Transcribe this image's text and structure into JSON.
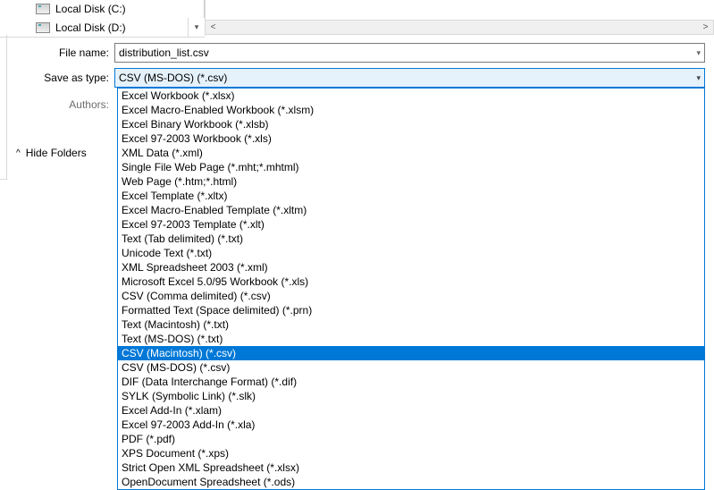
{
  "tree": {
    "items": [
      {
        "label": "Local Disk (C:)"
      },
      {
        "label": "Local Disk (D:)"
      }
    ]
  },
  "form": {
    "filename_label": "File name:",
    "filename_value": "distribution_list.csv",
    "saveastype_label": "Save as type:",
    "saveastype_value": "CSV (MS-DOS) (*.csv)",
    "authors_label": "Authors:"
  },
  "hide_folders_label": "Hide Folders",
  "dropdown": {
    "selected_index": 18,
    "options": [
      "Excel Workbook (*.xlsx)",
      "Excel Macro-Enabled Workbook (*.xlsm)",
      "Excel Binary Workbook (*.xlsb)",
      "Excel 97-2003 Workbook (*.xls)",
      "XML Data (*.xml)",
      "Single File Web Page (*.mht;*.mhtml)",
      "Web Page (*.htm;*.html)",
      "Excel Template (*.xltx)",
      "Excel Macro-Enabled Template (*.xltm)",
      "Excel 97-2003 Template (*.xlt)",
      "Text (Tab delimited) (*.txt)",
      "Unicode Text (*.txt)",
      "XML Spreadsheet 2003 (*.xml)",
      "Microsoft Excel 5.0/95 Workbook (*.xls)",
      "CSV (Comma delimited) (*.csv)",
      "Formatted Text (Space delimited) (*.prn)",
      "Text (Macintosh) (*.txt)",
      "Text (MS-DOS) (*.txt)",
      "CSV (Macintosh) (*.csv)",
      "CSV (MS-DOS) (*.csv)",
      "DIF (Data Interchange Format) (*.dif)",
      "SYLK (Symbolic Link) (*.slk)",
      "Excel Add-In (*.xlam)",
      "Excel 97-2003 Add-In (*.xla)",
      "PDF (*.pdf)",
      "XPS Document (*.xps)",
      "Strict Open XML Spreadsheet (*.xlsx)",
      "OpenDocument Spreadsheet (*.ods)"
    ]
  }
}
